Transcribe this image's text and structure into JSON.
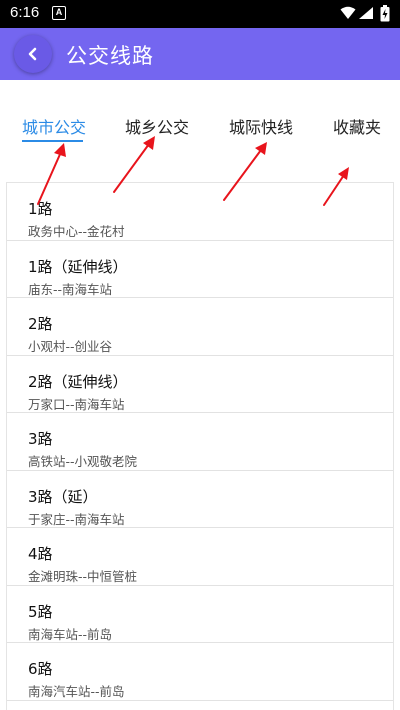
{
  "status_bar": {
    "time": "6:16",
    "notification_icon": "A"
  },
  "app_bar": {
    "title": "公交线路",
    "back_icon": "chevron-left-icon"
  },
  "tabs": [
    {
      "label": "城市公交",
      "active": true
    },
    {
      "label": "城乡公交",
      "active": false
    },
    {
      "label": "城际快线",
      "active": false
    },
    {
      "label": "收藏夹",
      "active": false
    }
  ],
  "routes": [
    {
      "name": "1路",
      "desc": "政务中心--金花村"
    },
    {
      "name": "1路（延伸线）",
      "desc": "庙东--南海车站"
    },
    {
      "name": "2路",
      "desc": "小观村--创业谷"
    },
    {
      "name": "2路（延伸线）",
      "desc": "万家口--南海车站"
    },
    {
      "name": "3路",
      "desc": "高铁站--小观敬老院"
    },
    {
      "name": "3路（延）",
      "desc": "于家庄--南海车站"
    },
    {
      "name": "4路",
      "desc": "金滩明珠--中恒管桩"
    },
    {
      "name": "5路",
      "desc": "南海车站--前岛"
    },
    {
      "name": "6路",
      "desc": "南海汽车站--前岛"
    }
  ],
  "colors": {
    "accent": "#7466f0",
    "active_tab": "#2b8be6",
    "annotation_arrow": "#e8141c"
  }
}
